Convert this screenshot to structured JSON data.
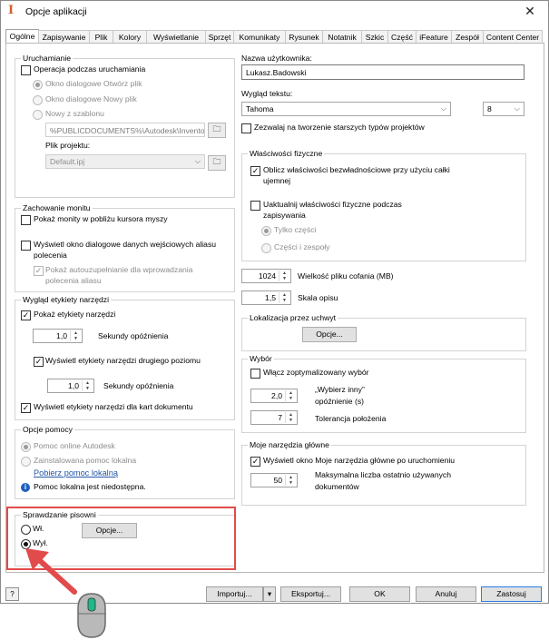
{
  "window": {
    "title": "Opcje aplikacji",
    "close": "✕"
  },
  "tabs": [
    "Ogólne",
    "Zapisywanie",
    "Plik",
    "Kolory",
    "Wyświetlanie",
    "Sprzęt",
    "Komunikaty",
    "Rysunek",
    "Notatnik",
    "Szkic",
    "Część",
    "iFeature",
    "Zespół",
    "Content Center"
  ],
  "startup": {
    "title": "Uruchamianie",
    "operation": "Operacja podczas uruchamiania",
    "open_dialog": "Okno dialogowe Otwórz plik",
    "new_dialog": "Okno dialogowe Nowy plik",
    "from_template": "Nowy z szablonu",
    "template_path": "%PUBLICDOCUMENTS%\\Autodesk\\Inventor",
    "project_label": "Plik projektu:",
    "project_value": "Default.ipj"
  },
  "prompts": {
    "title": "Zachowanie monitu",
    "show_near_cursor": "Pokaż monity w pobliżu kursora myszy",
    "show_alias_dialog_1": "Wyświetl okno dialogowe danych wejściowych aliasu",
    "show_alias_dialog_2": "polecenia",
    "autocomplete_1": "Pokaż autouzupełnianie dla wprowadzania",
    "autocomplete_2": "polecenia aliasu"
  },
  "tooltips": {
    "title": "Wygląd etykiety narzędzi",
    "show": "Pokaż etykiety narzędzi",
    "delay_value": "1,0",
    "delay_label": "Sekundy opóźnienia",
    "show_second": "Wyświetl etykiety narzędzi drugiego poziomu",
    "delay2_value": "1,0",
    "delay2_label": "Sekundy opóźnienia",
    "document_tabs": "Wyświetl etykiety narzędzi dla kart dokumentu"
  },
  "help": {
    "title": "Opcje pomocy",
    "online": "Pomoc online Autodesk",
    "local": "Zainstalowana pomoc lokalna",
    "download_link": "Pobierz pomoc lokalną",
    "info_icon": "info-icon",
    "status": "Pomoc lokalna jest niedostępna."
  },
  "spellcheck": {
    "title": "Sprawdzanie pisowni",
    "on": "Wł.",
    "off": "Wył.",
    "options": "Opcje..."
  },
  "user": {
    "label": "Nazwa użytkownika:",
    "value": "Lukasz.Badowski"
  },
  "text_appearance": {
    "label": "Wygląd tekstu:",
    "font": "Tahoma",
    "size": "8",
    "legacy": "Zezwalaj na tworzenie starszych typów projektów"
  },
  "physical": {
    "title": "Właściwości fizyczne",
    "calc_1": "Oblicz właściwości bezwładnościowe przy użyciu całki",
    "calc_2": "ujemnej",
    "update_1": "Uaktualnij właściwości fizyczne podczas",
    "update_2": "zapisywania",
    "parts_only": "Tylko części",
    "parts_assemblies": "Części i zespoły"
  },
  "undo": {
    "value": "1024",
    "label": "Wielkość pliku cofania (MB)"
  },
  "annotation_scale": {
    "value": "1,5",
    "label": "Skala opisu"
  },
  "shared_location": {
    "title": "Lokalizacja przez uchwyt",
    "options": "Opcje..."
  },
  "selection": {
    "title": "Wybór",
    "optimized": "Włącz zoptymalizowany wybór",
    "delay_value": "2,0",
    "delay_label_1": "„Wybierz inny”",
    "delay_label_2": "opóźnienie (s)",
    "tolerance_value": "7",
    "tolerance_label": "Tolerancja położenia"
  },
  "my_home": {
    "title": "Moje narzędzia główne",
    "show_on_start": "Wyświetl okno Moje narzędzia główne po uruchomieniu",
    "max_value": "50",
    "max_label_1": "Maksymalna liczba ostatnio używanych",
    "max_label_2": "dokumentów"
  },
  "footer": {
    "help_icon": "help-icon",
    "import": "Importuj...",
    "export": "Eksportuj...",
    "ok": "OK",
    "cancel": "Anuluj",
    "apply": "Zastosuj"
  },
  "colors": {
    "highlight_box": "#e24b4b",
    "arrow": "#e24b4b",
    "mouse_button": "#1fb88a"
  }
}
